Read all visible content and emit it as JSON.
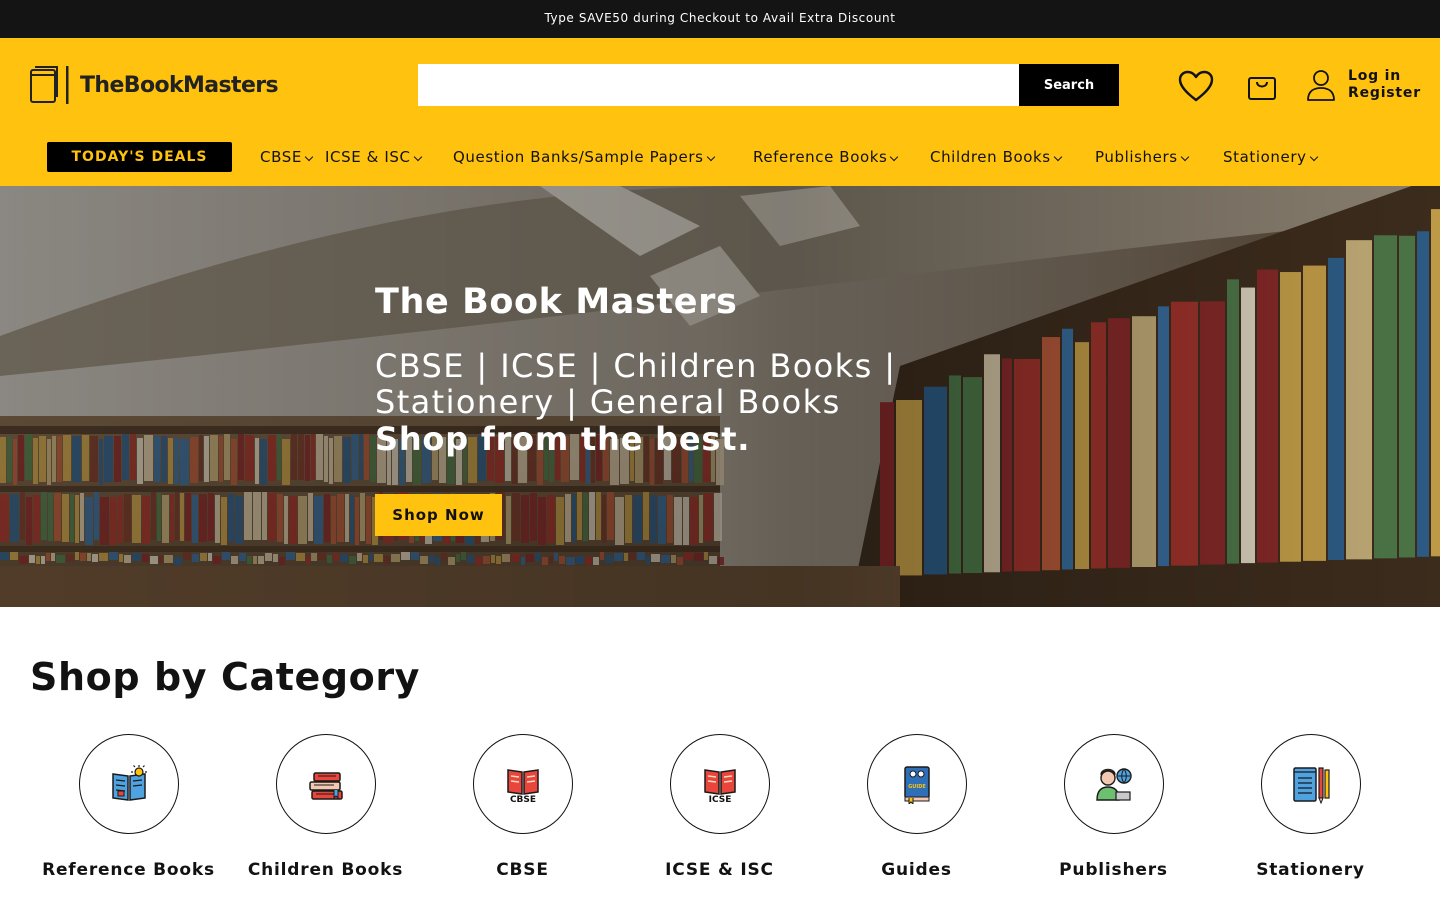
{
  "announcement": {
    "text": "Type SAVE50 during Checkout to Avail Extra Discount"
  },
  "header": {
    "logo_text": "TheBookMasters",
    "search": {
      "button_label": "Search",
      "value": ""
    },
    "wishlist_icon": "heart-icon",
    "cart_icon": "bag-icon",
    "account": {
      "icon": "user-icon",
      "login_label": "Log in",
      "register_label": "Register"
    }
  },
  "nav": {
    "deals_label": "TODAY'S DEALS",
    "items": [
      {
        "label": "CBSE"
      },
      {
        "label": "ICSE & ISC"
      },
      {
        "label": "Question Banks/Sample Papers"
      },
      {
        "label": "Reference Books"
      },
      {
        "label": "Children Books"
      },
      {
        "label": "Publishers"
      },
      {
        "label": "Stationery"
      }
    ]
  },
  "hero": {
    "title": "The Book Masters",
    "subtitle": "CBSE | ICSE | Children Books | Stationery | General Books",
    "tagline": "Shop from the best.",
    "button_label": "Shop Now"
  },
  "categories": {
    "title": "Shop by Category",
    "items": [
      {
        "label": "Reference Books",
        "icon": "reading-book-icon"
      },
      {
        "label": "Children Books",
        "icon": "book-stack-icon"
      },
      {
        "label": "CBSE",
        "icon": "cbse-book-icon",
        "badge": "CBSE"
      },
      {
        "label": "ICSE & ISC",
        "icon": "icse-book-icon",
        "badge": "ICSE"
      },
      {
        "label": "Guides",
        "icon": "guide-book-icon",
        "badge": "GUIDE"
      },
      {
        "label": "Publishers",
        "icon": "publisher-icon"
      },
      {
        "label": "Stationery",
        "icon": "stationery-icon"
      }
    ]
  },
  "colors": {
    "brand_yellow": "#ffc20e",
    "dark": "#141414",
    "text": "#121212"
  }
}
